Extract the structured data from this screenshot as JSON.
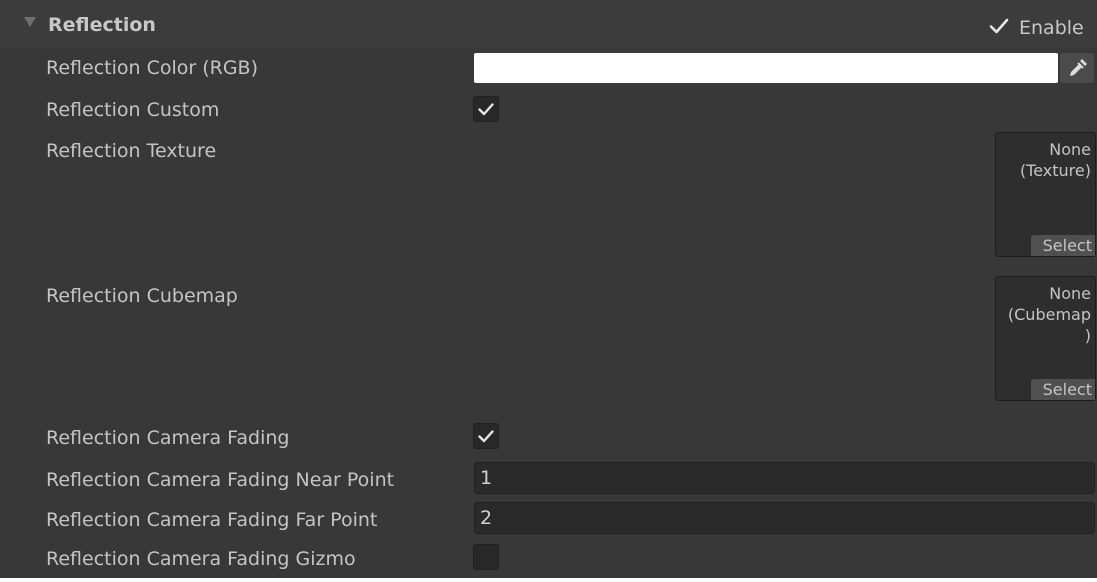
{
  "header": {
    "title": "Reflection",
    "enable_label": "Enable",
    "enable_checked": true
  },
  "fields": {
    "color_label": "Reflection Color (RGB)",
    "color_value": "#ffffff",
    "custom_label": "Reflection Custom",
    "custom_checked": true,
    "texture_label": "Reflection Texture",
    "texture_value": "None\n(Texture)",
    "texture_select": "Select",
    "cubemap_label": "Reflection Cubemap",
    "cubemap_value": "None\n(Cubemap\n)",
    "cubemap_select": "Select",
    "fading_label": "Reflection Camera Fading",
    "fading_checked": true,
    "near_label": "Reflection Camera Fading Near Point",
    "near_value": "1",
    "far_label": "Reflection Camera Fading Far Point",
    "far_value": "2",
    "gizmo_label": "Reflection Camera Fading Gizmo",
    "gizmo_checked": false
  },
  "icons": {
    "foldout": "triangle-down-icon",
    "checkmark": "checkmark-icon",
    "eyedropper": "eyedropper-icon"
  },
  "colors": {
    "panel_bg": "#383838",
    "field_bg": "#2a2a2a",
    "text": "#c4c4c4"
  }
}
